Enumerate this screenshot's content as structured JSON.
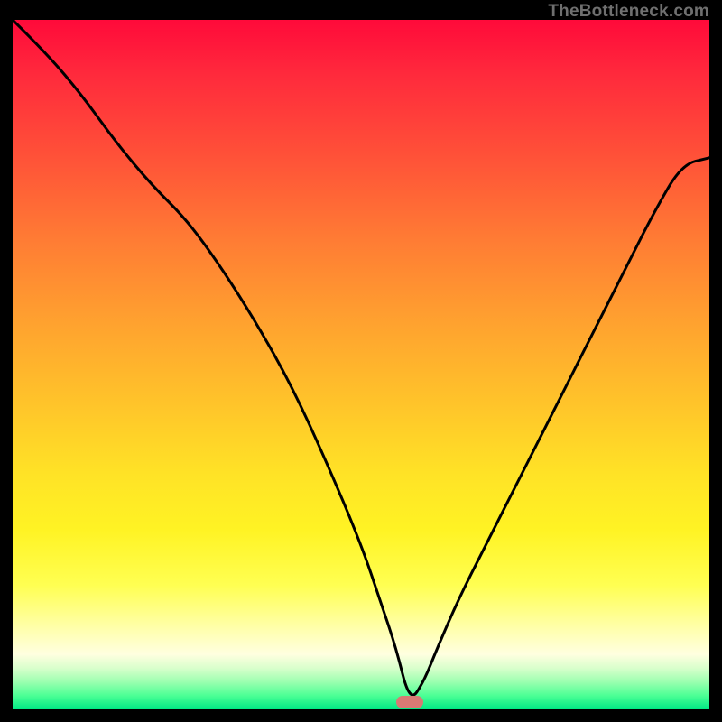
{
  "source_label": "TheBottleneck.com",
  "colors": {
    "page_bg": "#000000",
    "line": "#000000",
    "marker": "#d87a74"
  },
  "chart_data": {
    "type": "line",
    "title": "",
    "xlabel": "",
    "ylabel": "",
    "xlim": [
      0,
      100
    ],
    "ylim": [
      0,
      100
    ],
    "grid": false,
    "legend": false,
    "marker": {
      "x": 57,
      "y": 1,
      "color": "#d87a74"
    },
    "series": [
      {
        "name": "bottleneck-curve",
        "x": [
          0,
          5,
          10,
          15,
          20,
          25,
          30,
          35,
          40,
          45,
          50,
          53,
          55,
          57,
          59,
          61,
          64,
          68,
          72,
          76,
          80,
          84,
          88,
          92,
          96,
          100
        ],
        "values": [
          100,
          95,
          89,
          82,
          76,
          71,
          64,
          56,
          47,
          36,
          24,
          15,
          9,
          1,
          4,
          9,
          16,
          24,
          32,
          40,
          48,
          56,
          64,
          72,
          79,
          80
        ]
      }
    ]
  }
}
